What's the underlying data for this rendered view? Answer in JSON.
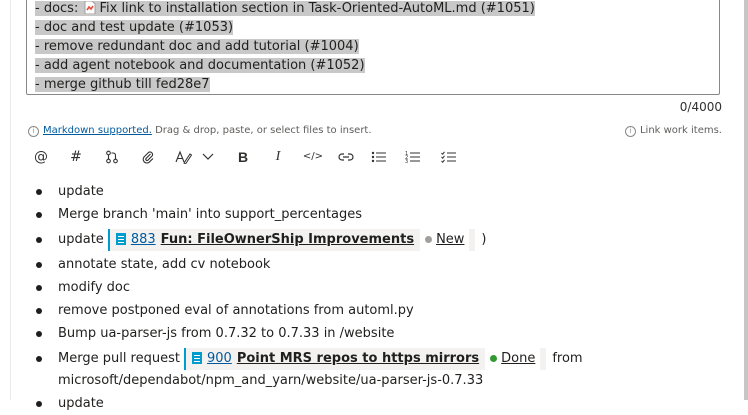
{
  "editor": {
    "lines": [
      {
        "prefix": "- docs: ",
        "has_icon": true,
        "text": "Fix link to installation section in Task-Oriented-AutoML.md (#1051)"
      },
      {
        "prefix": "- doc and test update (#1053)",
        "has_icon": false,
        "text": ""
      },
      {
        "prefix": "- remove redundant doc and add tutorial (#1004)",
        "has_icon": false,
        "text": ""
      },
      {
        "prefix": "- add agent notebook and documentation (#1052)",
        "has_icon": false,
        "text": ""
      },
      {
        "prefix": "- merge github till fed28e7",
        "has_icon": false,
        "text": ""
      }
    ],
    "counter": "0/4000"
  },
  "hints": {
    "markdown_link": "Markdown supported.",
    "markdown_rest": " Drag & drop, paste, or select files to insert.",
    "link_work_items": "Link work items."
  },
  "toolbar": {
    "icons": [
      "at-mention-icon",
      "hash-icon",
      "pull-request-icon",
      "attach-icon",
      "format-text-icon",
      "chevron-down-icon",
      "bold-icon",
      "italic-icon",
      "code-icon",
      "link-icon",
      "bulleted-list-icon",
      "numbered-list-icon",
      "checklist-icon"
    ],
    "glyphs": [
      "@",
      "#",
      "",
      "",
      "",
      "",
      "B",
      "I",
      "</>",
      "",
      "",
      "",
      ""
    ]
  },
  "commits": [
    {
      "text": "update"
    },
    {
      "text": "Merge branch 'main' into support_percentages"
    },
    {
      "text": "update",
      "work_item": {
        "number": "883",
        "title": "Fun: FileOwnerShip Improvements",
        "state": "New",
        "state_color": "#a19f9d"
      },
      "after": ")"
    },
    {
      "text": "annotate state, add cv notebook"
    },
    {
      "text": "modify doc"
    },
    {
      "text": "remove postponed eval of annotations from automl.py"
    },
    {
      "text": "Bump ua-parser-js from 0.7.32 to 0.7.33 in /website"
    },
    {
      "text": "Merge pull request",
      "work_item": {
        "number": "900",
        "title": "Point MRS repos to https mirrors",
        "state": "Done",
        "state_color": "#339933"
      },
      "after": "from",
      "continuation": "microsoft/dependabot/npm_and_yarn/website/ua-parser-js-0.7.33"
    },
    {
      "text": "update"
    }
  ],
  "colors": {
    "accent": "#005a9e",
    "work_item_blue": "#009ccc",
    "selection": "#c8c8c8"
  }
}
